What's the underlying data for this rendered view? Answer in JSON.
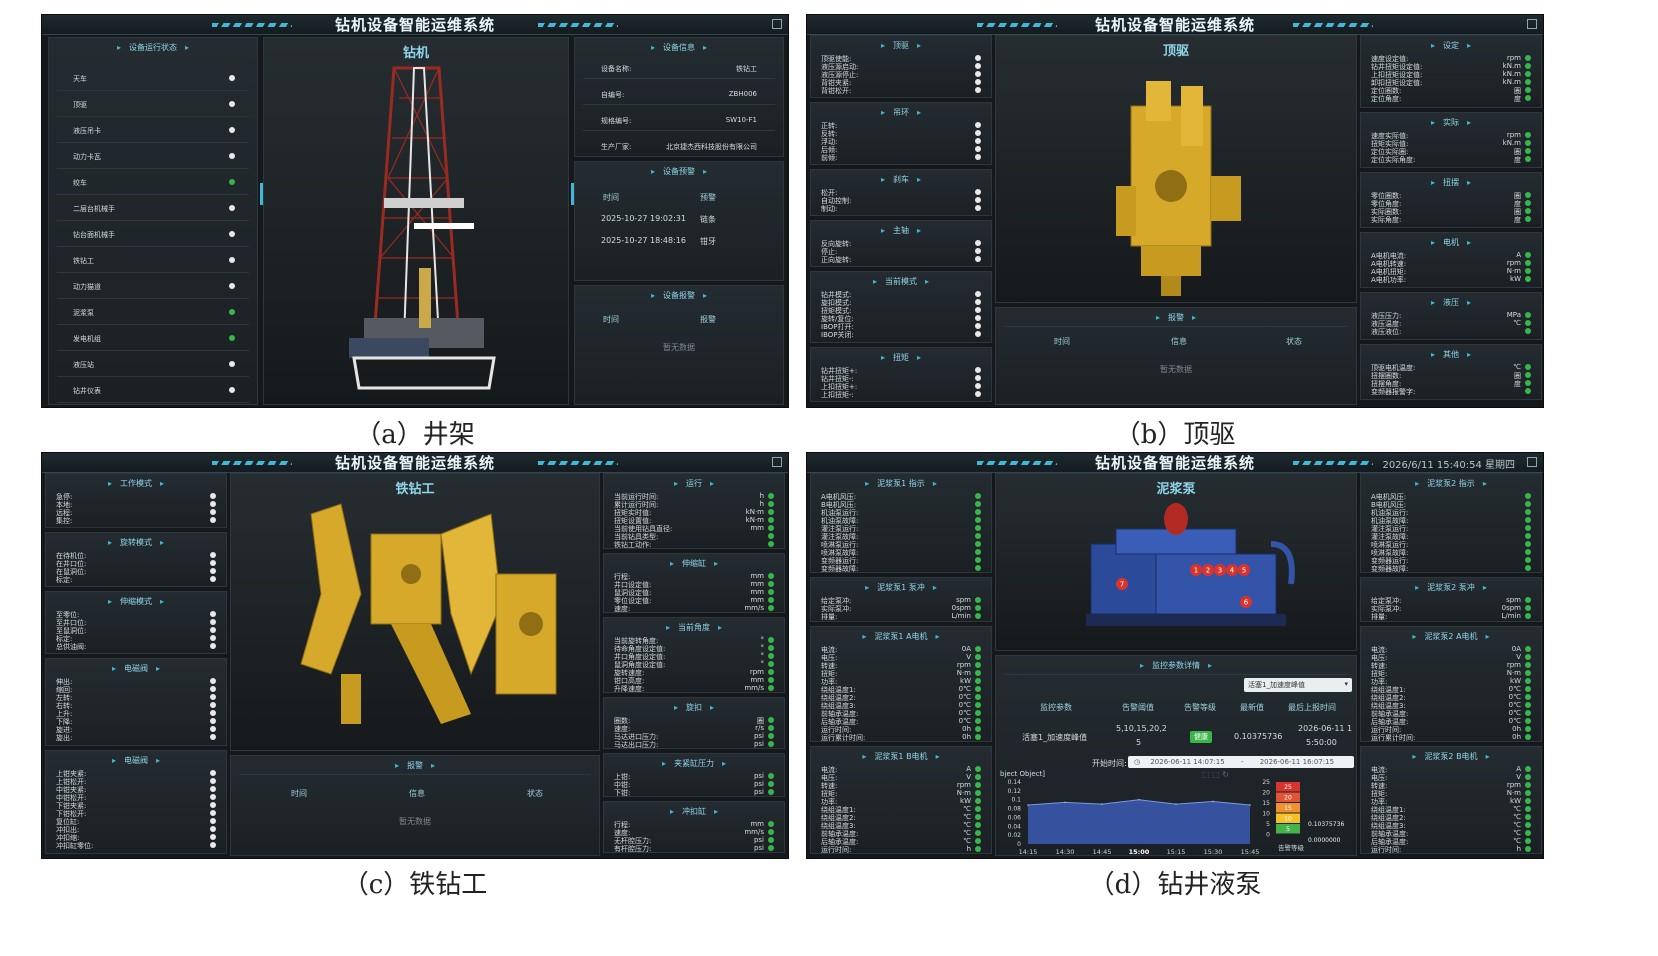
{
  "system_title": "钻机设备智能运维系统",
  "captions": {
    "a": "（a）井架",
    "b": "（b）顶驱",
    "c": "（c）铁钻工",
    "d": "（d）钻井液泵"
  },
  "a": {
    "status_title": "设备运行状态",
    "status_items": [
      {
        "label": "天车",
        "ok": false
      },
      {
        "label": "顶驱",
        "ok": false
      },
      {
        "label": "液压吊卡",
        "ok": false
      },
      {
        "label": "动力卡瓦",
        "ok": false
      },
      {
        "label": "绞车",
        "ok": true
      },
      {
        "label": "二层台机械手",
        "ok": false
      },
      {
        "label": "钻台面机械手",
        "ok": false
      },
      {
        "label": "铁钻工",
        "ok": false
      },
      {
        "label": "动力猫道",
        "ok": false
      },
      {
        "label": "泥浆泵",
        "ok": true
      },
      {
        "label": "发电机组",
        "ok": true
      },
      {
        "label": "液压站",
        "ok": false
      },
      {
        "label": "钻井仪表",
        "ok": false
      }
    ],
    "center_title": "钻机",
    "info_title": "设备信息",
    "info_rows": [
      {
        "k": "设备名称:",
        "v": "铁钻工"
      },
      {
        "k": "自编号:",
        "v": "ZBH006"
      },
      {
        "k": "规格编号:",
        "v": "SW10-F1"
      },
      {
        "k": "生产厂家:",
        "v": "北京捷杰西科技股份有限公司"
      }
    ],
    "warn_title": "设备预警",
    "warn_cols": [
      "时间",
      "预警"
    ],
    "warn_rows": [
      {
        "time": "2025-10-27 19:02:31",
        "msg": "链条"
      },
      {
        "time": "2025-10-27 18:48:16",
        "msg": "钳牙"
      }
    ],
    "alarm_title": "设备报警",
    "alarm_cols": [
      "时间",
      "报警"
    ],
    "nodata": "暂无数据"
  },
  "b": {
    "center_title": "顶驱",
    "left_panels": [
      {
        "title": "顶驱",
        "rows": [
          "顶驱使能:",
          "液压源启动:",
          "液压源停止:",
          "背钳夹紧:",
          "背钳松开:"
        ]
      },
      {
        "title": "吊环",
        "rows": [
          "正转:",
          "反转:",
          "浮动:",
          "后倾:",
          "前倾:"
        ]
      },
      {
        "title": "刹车",
        "rows": [
          "松开:",
          "自动控制:",
          "制动:"
        ]
      },
      {
        "title": "主轴",
        "rows": [
          "反向旋转:",
          "停止:",
          "正向旋转:"
        ]
      },
      {
        "title": "当前模式",
        "rows": [
          "钻井模式:",
          "旋扣模式:",
          "扭矩模式:",
          "旋转/复位:",
          "IBOP打开:",
          "IBOP关闭:"
        ]
      },
      {
        "title": "扭矩",
        "rows": [
          "钻井扭矩+:",
          "钻井扭矩-:",
          "上扣扭矩+:",
          "上扣扭矩-:"
        ]
      }
    ],
    "right_panels": [
      {
        "title": "设定",
        "rows": [
          {
            "k": "速度设定值:",
            "u": "rpm"
          },
          {
            "k": "钻井扭矩设定值:",
            "u": "kN.m"
          },
          {
            "k": "上扣扭矩设定值:",
            "u": "kN.m"
          },
          {
            "k": "卸扣扭矩设定值:",
            "u": "kN.m"
          },
          {
            "k": "定位圈数:",
            "u": "圈"
          },
          {
            "k": "定位角度:",
            "u": "度"
          }
        ]
      },
      {
        "title": "实际",
        "rows": [
          {
            "k": "速度实际值:",
            "u": "rpm"
          },
          {
            "k": "扭矩实际值:",
            "u": "kN.m"
          },
          {
            "k": "定位实际圈:",
            "u": "圈"
          },
          {
            "k": "定位实际角度:",
            "u": "度"
          }
        ]
      },
      {
        "title": "扭摆",
        "rows": [
          {
            "k": "零位圈数:",
            "u": "圈"
          },
          {
            "k": "零位角度:",
            "u": "度"
          },
          {
            "k": "实际圈数:",
            "u": "圈"
          },
          {
            "k": "实际角度:",
            "u": "度"
          }
        ]
      },
      {
        "title": "电机",
        "rows": [
          {
            "k": "A电机电流:",
            "u": "A"
          },
          {
            "k": "A电机转速:",
            "u": "rpm"
          },
          {
            "k": "A电机扭矩:",
            "u": "N·m"
          },
          {
            "k": "A电机功率:",
            "u": "kW"
          }
        ]
      },
      {
        "title": "液压",
        "rows": [
          {
            "k": "液压压力:",
            "u": "MPa"
          },
          {
            "k": "液压温度:",
            "u": "℃"
          },
          {
            "k": "液压液位:",
            "u": ""
          }
        ]
      },
      {
        "title": "其他",
        "rows": [
          {
            "k": "顶驱电机温度:",
            "u": "℃"
          },
          {
            "k": "扭摆圈数:",
            "u": "圈"
          },
          {
            "k": "扭摆角度:",
            "u": "度"
          },
          {
            "k": "变频器报警字:",
            "u": ""
          }
        ]
      }
    ],
    "alarm_title": "报警",
    "alarm_cols": [
      "时间",
      "信息",
      "状态"
    ],
    "nodata": "暂无数据"
  },
  "c": {
    "center_title": "铁钻工",
    "left_panels": [
      {
        "title": "工作模式",
        "rows": [
          "急停:",
          "本地:",
          "远程:",
          "集控:"
        ]
      },
      {
        "title": "旋转模式",
        "rows": [
          "在待机位:",
          "在井口位:",
          "在鼠洞位:",
          "标定:"
        ]
      },
      {
        "title": "伸缩模式",
        "rows": [
          "至零位:",
          "至井口位:",
          "至鼠洞位:",
          "标定:",
          "总供油阀:"
        ]
      },
      {
        "title": "电磁阀",
        "rows": [
          "伸出:",
          "缩回:",
          "左转:",
          "右转:",
          "上升:",
          "下降:",
          "旋进:",
          "旋出:"
        ]
      },
      {
        "title": "电磁阀",
        "rows": [
          "上钳夹紧:",
          "上钳松开:",
          "中钳夹紧:",
          "中钳松开:",
          "下钳夹紧:",
          "下钳松开:",
          "复位缸:",
          "冲扣出:",
          "冲扣缩:",
          "冲扣缸零位:"
        ]
      }
    ],
    "right_panels": [
      {
        "title": "运行",
        "rows": [
          {
            "k": "当前运行时间:",
            "u": "h"
          },
          {
            "k": "累计运行时间:",
            "u": "h"
          },
          {
            "k": "扭矩实时值:",
            "u": "kN·m"
          },
          {
            "k": "扭矩设置值:",
            "u": "kN·m"
          },
          {
            "k": "当前使用钻具直径:",
            "u": "mm"
          },
          {
            "k": "当前钻具类型:",
            "u": ""
          },
          {
            "k": "铁钻工动作:",
            "u": ""
          }
        ]
      },
      {
        "title": "伸缩缸",
        "rows": [
          {
            "k": "行程:",
            "u": "mm"
          },
          {
            "k": "井口设定值:",
            "u": "mm"
          },
          {
            "k": "鼠洞设定值:",
            "u": "mm"
          },
          {
            "k": "零位设定值:",
            "u": "mm"
          },
          {
            "k": "速度:",
            "u": "mm/s"
          }
        ]
      },
      {
        "title": "当前角度",
        "rows": [
          {
            "k": "当前旋转角度:",
            "u": "°"
          },
          {
            "k": "待命角度设定值:",
            "u": "°"
          },
          {
            "k": "井口角度设定值:",
            "u": "°"
          },
          {
            "k": "鼠洞角度设定值:",
            "u": "°"
          },
          {
            "k": "旋转速度:",
            "u": "rpm"
          },
          {
            "k": "钳口高度:",
            "u": "mm"
          },
          {
            "k": "升降速度:",
            "u": "mm/s"
          }
        ]
      },
      {
        "title": "旋扣",
        "rows": [
          {
            "k": "圈数:",
            "u": "圈"
          },
          {
            "k": "速度:",
            "u": "r/s"
          },
          {
            "k": "马达进口压力:",
            "u": "psi"
          },
          {
            "k": "马达出口压力:",
            "u": "psi"
          }
        ]
      },
      {
        "title": "夹紧缸压力",
        "rows": [
          {
            "k": "上钳:",
            "u": "psi"
          },
          {
            "k": "中钳:",
            "u": "psi"
          },
          {
            "k": "下钳:",
            "u": "psi"
          }
        ]
      },
      {
        "title": "冲扣缸",
        "rows": [
          {
            "k": "行程:",
            "u": "mm"
          },
          {
            "k": "速度:",
            "u": "mm/s"
          },
          {
            "k": "无杆腔压力:",
            "u": "psi"
          },
          {
            "k": "有杆腔压力:",
            "u": "psi"
          }
        ]
      }
    ],
    "alarm_title": "报警",
    "alarm_cols": [
      "时间",
      "信息",
      "状态"
    ],
    "nodata": "暂无数据"
  },
  "d": {
    "datetime": "2026/6/11 15:40:54 星期四",
    "center_title": "泥浆泵",
    "left_panels": [
      {
        "title": "泥浆泵1 指示",
        "rows": [
          {
            "k": "A电机风压:",
            "u": ""
          },
          {
            "k": "B电机风压:",
            "u": ""
          },
          {
            "k": "机油泵运行:",
            "u": ""
          },
          {
            "k": "机油泵故障:",
            "u": ""
          },
          {
            "k": "灌注泵运行:",
            "u": ""
          },
          {
            "k": "灌注泵故障:",
            "u": ""
          },
          {
            "k": "喷淋泵运行:",
            "u": ""
          },
          {
            "k": "喷淋泵故障:",
            "u": ""
          },
          {
            "k": "变频器运行:",
            "u": ""
          },
          {
            "k": "变频器故障:",
            "u": ""
          }
        ]
      },
      {
        "title": "泥浆泵1 泵冲",
        "rows": [
          {
            "k": "给定泵冲:",
            "u": "spm"
          },
          {
            "k": "实际泵冲:",
            "u": "0spm"
          },
          {
            "k": "排量:",
            "u": "L/min"
          }
        ]
      },
      {
        "title": "泥浆泵1 A电机",
        "rows": [
          {
            "k": "电流:",
            "u": "0A"
          },
          {
            "k": "电压:",
            "u": "V"
          },
          {
            "k": "转速:",
            "u": "rpm"
          },
          {
            "k": "扭矩:",
            "u": "N·m"
          },
          {
            "k": "功率:",
            "u": "kW"
          },
          {
            "k": "绕组温度1:",
            "u": "0℃"
          },
          {
            "k": "绕组温度2:",
            "u": "0℃"
          },
          {
            "k": "绕组温度3:",
            "u": "0℃"
          },
          {
            "k": "前轴承温度:",
            "u": "0℃"
          },
          {
            "k": "后轴承温度:",
            "u": "0℃"
          },
          {
            "k": "运行时间:",
            "u": "0h"
          },
          {
            "k": "运行累计时间:",
            "u": "0h"
          }
        ]
      },
      {
        "title": "泥浆泵1 B电机",
        "rows": [
          {
            "k": "电流:",
            "u": "A"
          },
          {
            "k": "电压:",
            "u": "V"
          },
          {
            "k": "转速:",
            "u": "rpm"
          },
          {
            "k": "扭矩:",
            "u": "N·m"
          },
          {
            "k": "功率:",
            "u": "kW"
          },
          {
            "k": "绕组温度1:",
            "u": "℃"
          },
          {
            "k": "绕组温度2:",
            "u": "℃"
          },
          {
            "k": "绕组温度3:",
            "u": "℃"
          },
          {
            "k": "前轴承温度:",
            "u": "℃"
          },
          {
            "k": "后轴承温度:",
            "u": "℃"
          },
          {
            "k": "运行时间:",
            "u": "h"
          }
        ]
      }
    ],
    "right_panels": [
      {
        "title": "泥浆泵2 指示",
        "rows": [
          {
            "k": "A电机风压:",
            "u": ""
          },
          {
            "k": "B电机风压:",
            "u": ""
          },
          {
            "k": "机油泵运行:",
            "u": ""
          },
          {
            "k": "机油泵故障:",
            "u": ""
          },
          {
            "k": "灌注泵运行:",
            "u": ""
          },
          {
            "k": "灌注泵故障:",
            "u": ""
          },
          {
            "k": "喷淋泵运行:",
            "u": ""
          },
          {
            "k": "喷淋泵故障:",
            "u": ""
          },
          {
            "k": "变频器运行:",
            "u": ""
          },
          {
            "k": "变频器故障:",
            "u": ""
          }
        ]
      },
      {
        "title": "泥浆泵2 泵冲",
        "rows": [
          {
            "k": "给定泵冲:",
            "u": "spm"
          },
          {
            "k": "实际泵冲:",
            "u": "0spm"
          },
          {
            "k": "排量:",
            "u": "L/min"
          }
        ]
      },
      {
        "title": "泥浆泵2 A电机",
        "rows": [
          {
            "k": "电流:",
            "u": "0A"
          },
          {
            "k": "电压:",
            "u": "V"
          },
          {
            "k": "转速:",
            "u": "rpm"
          },
          {
            "k": "扭矩:",
            "u": "N·m"
          },
          {
            "k": "功率:",
            "u": "kW"
          },
          {
            "k": "绕组温度1:",
            "u": "0℃"
          },
          {
            "k": "绕组温度2:",
            "u": "0℃"
          },
          {
            "k": "绕组温度3:",
            "u": "0℃"
          },
          {
            "k": "前轴承温度:",
            "u": "0℃"
          },
          {
            "k": "后轴承温度:",
            "u": "0℃"
          },
          {
            "k": "运行时间:",
            "u": "0h"
          },
          {
            "k": "运行累计时间:",
            "u": "0h"
          }
        ]
      },
      {
        "title": "泥浆泵2 B电机",
        "rows": [
          {
            "k": "电流:",
            "u": "A"
          },
          {
            "k": "电压:",
            "u": "V"
          },
          {
            "k": "转速:",
            "u": "rpm"
          },
          {
            "k": "扭矩:",
            "u": "N·m"
          },
          {
            "k": "功率:",
            "u": "kW"
          },
          {
            "k": "绕组温度1:",
            "u": "℃"
          },
          {
            "k": "绕组温度2:",
            "u": "℃"
          },
          {
            "k": "绕组温度3:",
            "u": "℃"
          },
          {
            "k": "前轴承温度:",
            "u": "℃"
          },
          {
            "k": "后轴承温度:",
            "u": "℃"
          },
          {
            "k": "运行时间:",
            "u": "h"
          }
        ]
      }
    ],
    "monitor": {
      "title": "监控参数详情",
      "select_value": "活塞1_加速度峰值",
      "cols": [
        "监控参数",
        "告警阈值",
        "告警等级",
        "最新值",
        "最后上报时间"
      ],
      "row": {
        "param": "活塞1_加速度峰值",
        "threshold_line1": "5,10,15,20,2",
        "threshold_line2": "5",
        "level": "健康",
        "latest": "0.10375736",
        "time_line1": "2026-06-11 1",
        "time_line2": "5:50:00"
      },
      "start_label": "开始时间:",
      "start": "2026-06-11 14:07:15",
      "end": "2026-06-11 16:07:15",
      "range_sep": "-",
      "chart_label": "bject Object]"
    },
    "pump_markers": [
      "7",
      "1",
      "2",
      "3",
      "4",
      "5",
      "6"
    ],
    "level_label": "告警等级",
    "level_readout_1": "0.10375736",
    "level_readout_2": "0.0000000"
  },
  "chart_data": {
    "type": "area",
    "x": [
      "14:15",
      "14:30",
      "14:45",
      "15:00",
      "15:15",
      "15:30",
      "15:45"
    ],
    "y_ticks": [
      0,
      0.02,
      0.04,
      0.06,
      0.08,
      0.1,
      0.12,
      0.14
    ],
    "ylim": [
      0,
      0.14
    ],
    "values": [
      0.088,
      0.094,
      0.09,
      0.1,
      0.09,
      0.096,
      0.088
    ],
    "highlight_tick": "15:00",
    "color": "#3b5bb5"
  },
  "level_gauge": {
    "ticks": [
      "25",
      "20",
      "15",
      "10",
      "5",
      "0"
    ],
    "bands": [
      {
        "label": "25",
        "color": "#d9342b"
      },
      {
        "label": "20",
        "color": "#e05535"
      },
      {
        "label": "15",
        "color": "#f0902e"
      },
      {
        "label": "10",
        "color": "#f6c028"
      },
      {
        "label": "5",
        "color": "#45b24a"
      }
    ]
  }
}
